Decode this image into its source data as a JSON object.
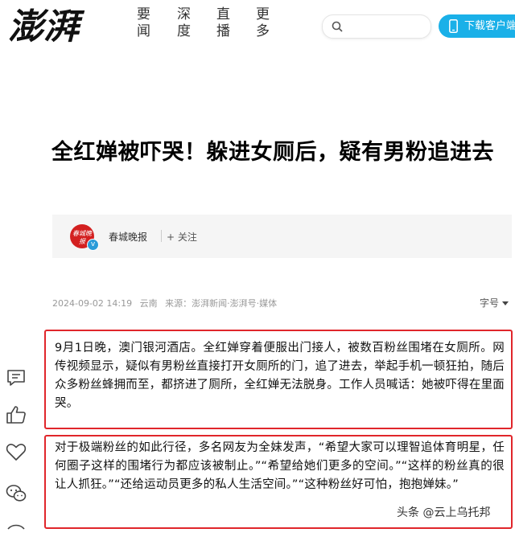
{
  "header": {
    "logo_text": "澎湃",
    "nav": [
      {
        "line1": "要",
        "line2": "闻"
      },
      {
        "line1": "深",
        "line2": "度"
      },
      {
        "line1": "直",
        "line2": "播"
      },
      {
        "line1": "更",
        "line2": "多"
      }
    ],
    "search_placeholder": "",
    "download_label": "下载客户端"
  },
  "article": {
    "title": "全红婵被吓哭！躲进女厕后，疑有男粉追进去",
    "author": {
      "name": "春城晚报",
      "avatar_text": "春城晚报",
      "verified_badge": "v",
      "follow_label": "+ 关注"
    },
    "meta": {
      "datetime": "2024-09-02 14:19",
      "location": "云南",
      "source": "来源：澎湃新闻·澎湃号·媒体"
    },
    "font_size_label": "字号",
    "paragraphs": [
      "9月1日晚，澳门银河酒店。全红婵穿着便服出门接人，被数百粉丝围堵在女厕所。网传视频显示，疑似有男粉丝直接打开女厕所的门，追了进去，举起手机一顿狂拍，随后众多粉丝蜂拥而至，都挤进了厕所，全红婵无法脱身。工作人员喊话：她被吓得在里面哭。",
      "对于极端粉丝的如此行径，多名网友为全妹发声，“希望大家可以理智追体育明星，任何圈子这样的围堵行为都应该被制止。”“希望给她们更多的空间。”“这样的粉丝真的很让人抓狂。”“还给运动员更多的私人生活空间。”“这种粉丝好可怕，抱抱婵妹。”"
    ]
  },
  "watermark": "头条 @云上乌托邦",
  "side_tools": [
    "comment-icon",
    "like-icon",
    "heart-icon",
    "wechat-icon"
  ],
  "colors": {
    "accent_blue": "#1ab0e8",
    "highlight_red": "#e0262b",
    "author_bg": "#f5f5f5"
  }
}
